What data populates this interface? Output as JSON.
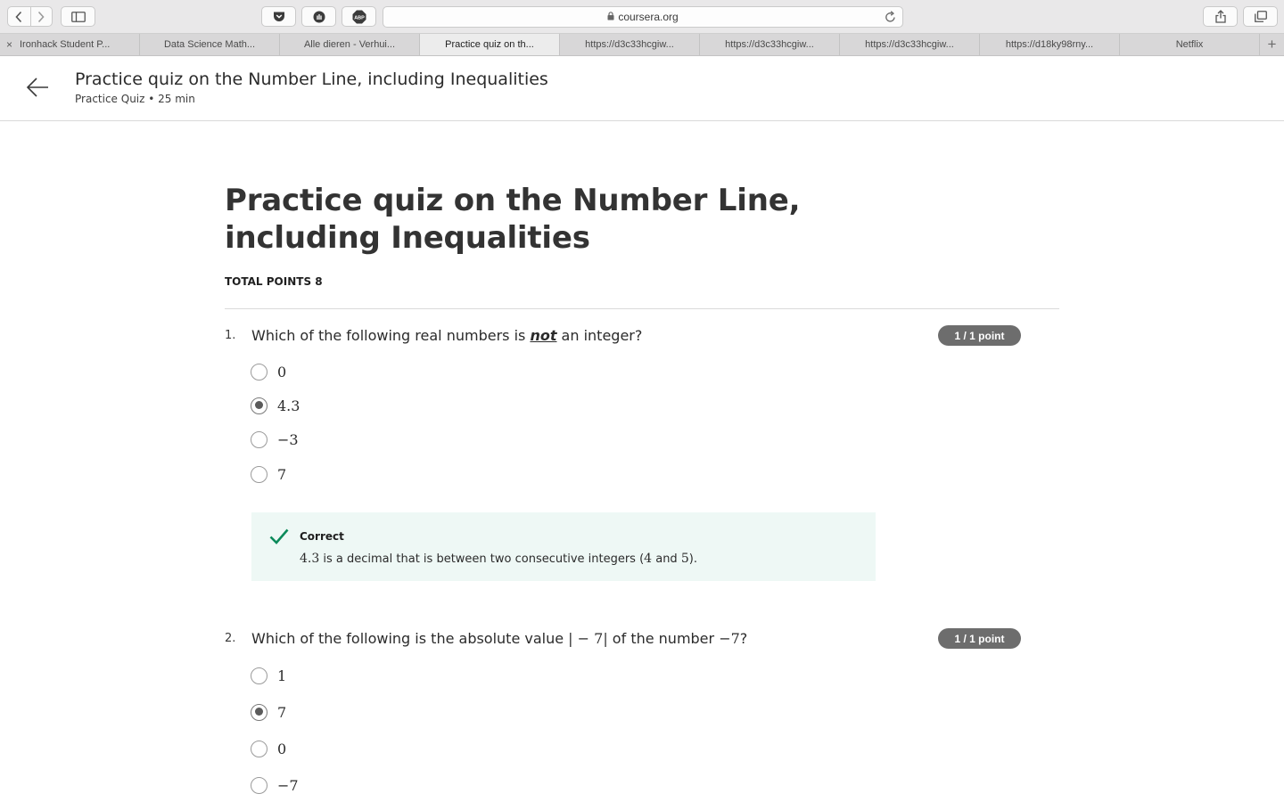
{
  "browser": {
    "url": "coursera.org",
    "icons": [
      "back-icon",
      "forward-icon",
      "sidebar-icon",
      "pocket-icon",
      "extension-icon",
      "adblock-icon",
      "lock-icon",
      "reload-icon",
      "share-icon",
      "tabs-overview-icon",
      "new-tab-icon"
    ],
    "adblock_label": "ABP",
    "tabs": [
      {
        "label": "Ironhack Student P...",
        "active": false
      },
      {
        "label": "Data Science Math...",
        "active": false
      },
      {
        "label": "Alle dieren - Verhui...",
        "active": false
      },
      {
        "label": "Practice quiz on th...",
        "active": true
      },
      {
        "label": "https://d3c33hcgiw...",
        "active": false
      },
      {
        "label": "https://d3c33hcgiw...",
        "active": false
      },
      {
        "label": "https://d3c33hcgiw...",
        "active": false
      },
      {
        "label": "https://d18ky98rny...",
        "active": false
      },
      {
        "label": "Netflix",
        "active": false
      }
    ],
    "new_tab_symbol": "+",
    "close_symbol": "×"
  },
  "header": {
    "title": "Practice quiz on the Number Line, including Inequalities",
    "subtitle": "Practice Quiz • 25 min"
  },
  "quiz": {
    "title": "Practice quiz on the Number Line, including Inequalities",
    "total_points": "TOTAL POINTS 8",
    "questions": [
      {
        "number": "1.",
        "text_before": "Which of the following real numbers is ",
        "text_emphasis": "not",
        "text_after": " an integer?",
        "score": "1 / 1 point",
        "options": [
          {
            "label": "0",
            "selected": false
          },
          {
            "label": "4.3",
            "selected": true
          },
          {
            "label": "−3",
            "selected": false
          },
          {
            "label": "7",
            "selected": false
          }
        ],
        "feedback": {
          "status": "Correct",
          "value": "4.3",
          "text_1": " is a decimal that is between two consecutive integers (",
          "int_a": "4",
          "text_2": " and ",
          "int_b": "5",
          "text_3": ")."
        }
      },
      {
        "number": "2.",
        "text_before": "Which of the following is the absolute value ",
        "text_math": "| − 7|",
        "text_mid": " of the number ",
        "text_math_2": "−7",
        "text_after": "?",
        "score": "1 / 1 point",
        "options": [
          {
            "label": "1",
            "selected": false
          },
          {
            "label": "7",
            "selected": true
          },
          {
            "label": "0",
            "selected": false
          },
          {
            "label": "−7",
            "selected": false
          }
        ]
      }
    ]
  },
  "colors": {
    "correct_green": "#0b8a5a",
    "feedback_bg": "#eef8f5",
    "badge_bg": "#6d6d6d"
  }
}
